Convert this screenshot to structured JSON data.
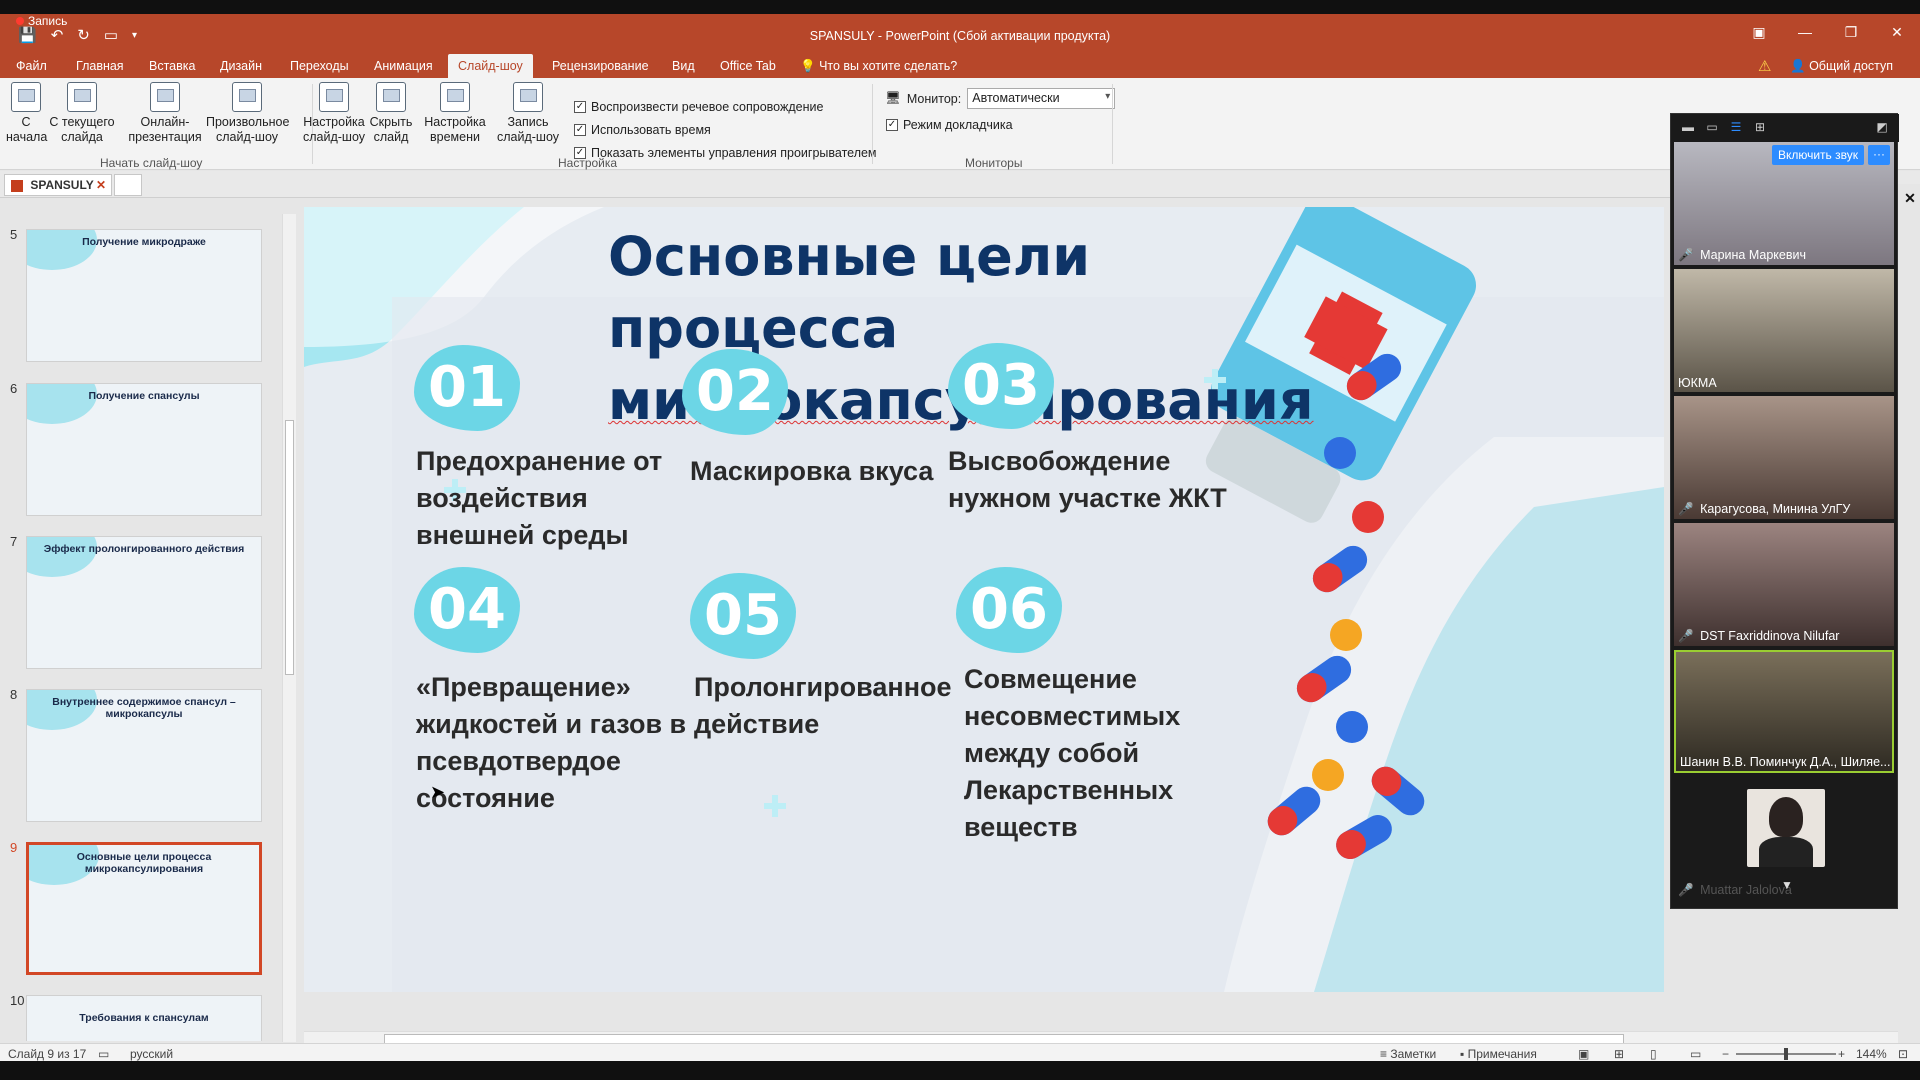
{
  "titlebar": {
    "recording_label": "Запись",
    "window_title": "SPANSULY - PowerPoint (Сбой активации продукта)"
  },
  "tabs": [
    {
      "label": "Файл",
      "active": false
    },
    {
      "label": "Главная",
      "active": false
    },
    {
      "label": "Вставка",
      "active": false
    },
    {
      "label": "Дизайн",
      "active": false
    },
    {
      "label": "Переходы",
      "active": false
    },
    {
      "label": "Анимация",
      "active": false
    },
    {
      "label": "Слайд-шоу",
      "active": true
    },
    {
      "label": "Рецензирование",
      "active": false
    },
    {
      "label": "Вид",
      "active": false
    },
    {
      "label": "Office Tab",
      "active": false
    }
  ],
  "tell_me": "Что вы хотите сделать?",
  "share": "Общий доступ",
  "ribbon": {
    "btn_from_start": "С начала",
    "btn_from_current": "С текущего слайда",
    "btn_online": "Онлайн-презентация",
    "btn_custom": "Произвольное слайд-шоу",
    "group_start": "Начать слайд-шоу",
    "btn_setup": "Настройка слайд-шоу",
    "btn_hide": "Скрыть слайд",
    "btn_timing": "Настройка времени",
    "btn_record": "Запись слайд-шоу",
    "chk_narration": "Воспроизвести речевое сопровождение",
    "chk_timings": "Использовать время",
    "chk_controls": "Показать элементы управления проигрывателем",
    "group_setup": "Настройка",
    "monitor_label": "Монитор:",
    "monitor_value": "Автоматически",
    "chk_presenter": "Режим докладчика",
    "group_monitors": "Мониторы"
  },
  "doc_tab": "SPANSULY",
  "thumbnails": [
    {
      "num": "5",
      "title": "Получение микродраже"
    },
    {
      "num": "6",
      "title": "Получение спансулы"
    },
    {
      "num": "7",
      "title": "Эффект пролонгированного действия"
    },
    {
      "num": "8",
      "title": "Внутреннее содержимое спансул – микрокапсулы"
    },
    {
      "num": "9",
      "title": "Основные цели процесса микрокапсулирования"
    },
    {
      "num": "10",
      "title": "Требования к спансулам"
    }
  ],
  "slide": {
    "title_line1": "Основные цели процесса",
    "title_line2": "микрокапсулирования",
    "goals": [
      {
        "num": "01",
        "text": "Предохранение от воздействия внешней среды"
      },
      {
        "num": "02",
        "text": "Маскировка вкуса"
      },
      {
        "num": "03",
        "text": "Высвобождение  нужном участке ЖКТ"
      },
      {
        "num": "04",
        "text": "«Превращение» жидкостей и газов в псевдотвердое состояние"
      },
      {
        "num": "05",
        "text": "Пролонгированное действие"
      },
      {
        "num": "06",
        "text": "Совмещение несовместимых между собой Лекарственных веществ"
      }
    ]
  },
  "zoom": {
    "unmute_label": "Включить звук",
    "participants": [
      {
        "name": "Марина Маркевич",
        "muted": true
      },
      {
        "name": "ЮКМА",
        "muted": false
      },
      {
        "name": "Карагусова, Минина УлГУ",
        "muted": true
      },
      {
        "name": "DST Faxriddinova Nilufar",
        "muted": true
      },
      {
        "name": "Шанин В.В. Поминчук Д.А., Шиляе...",
        "muted": false
      },
      {
        "name": "Muattar Jalolova",
        "muted": true
      }
    ]
  },
  "statusbar": {
    "slide_info": "Слайд 9 из 17",
    "language": "русский",
    "notes": "Заметки",
    "comments": "Примечания",
    "zoom": "144%"
  },
  "colors": {
    "ppt_accent": "#b7472a",
    "title_blue": "#0e3467",
    "badge_teal": "#6cd6e6",
    "zoom_blue": "#2d8cff"
  }
}
